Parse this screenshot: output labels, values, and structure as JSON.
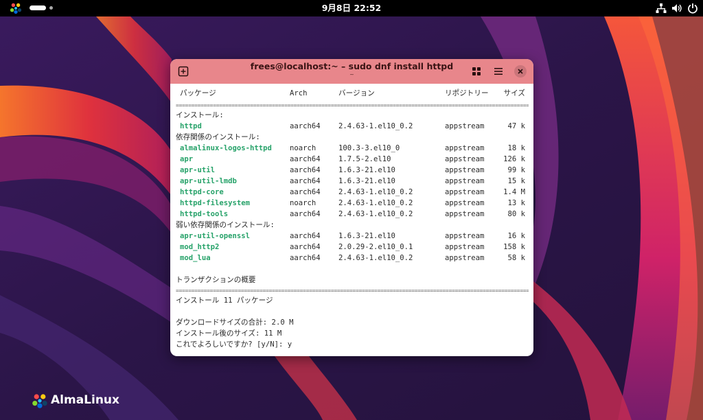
{
  "topbar": {
    "datetime": "9月8日  22:52"
  },
  "window": {
    "title": "frees@localhost:~ – sudo dnf install httpd",
    "subtitle": "~"
  },
  "terminal": {
    "headers": [
      "パッケージ",
      "Arch",
      "バージョン",
      "リポジトリー",
      "サイズ"
    ],
    "separator": "==================================================================================================================================",
    "install_label": "インストール:",
    "install_pkgs": [
      {
        "name": "httpd",
        "arch": "aarch64",
        "version": "2.4.63-1.el10_0.2",
        "repo": "appstream",
        "size": "47 k"
      }
    ],
    "dep_label": "依存関係のインストール:",
    "dep_pkgs": [
      {
        "name": "almalinux-logos-httpd",
        "arch": "noarch",
        "version": "100.3-3.el10_0",
        "repo": "appstream",
        "size": "18 k"
      },
      {
        "name": "apr",
        "arch": "aarch64",
        "version": "1.7.5-2.el10",
        "repo": "appstream",
        "size": "126 k"
      },
      {
        "name": "apr-util",
        "arch": "aarch64",
        "version": "1.6.3-21.el10",
        "repo": "appstream",
        "size": "99 k"
      },
      {
        "name": "apr-util-lmdb",
        "arch": "aarch64",
        "version": "1.6.3-21.el10",
        "repo": "appstream",
        "size": "15 k"
      },
      {
        "name": "httpd-core",
        "arch": "aarch64",
        "version": "2.4.63-1.el10_0.2",
        "repo": "appstream",
        "size": "1.4 M"
      },
      {
        "name": "httpd-filesystem",
        "arch": "noarch",
        "version": "2.4.63-1.el10_0.2",
        "repo": "appstream",
        "size": "13 k"
      },
      {
        "name": "httpd-tools",
        "arch": "aarch64",
        "version": "2.4.63-1.el10_0.2",
        "repo": "appstream",
        "size": "80 k"
      }
    ],
    "weak_label": "弱い依存関係のインストール:",
    "weak_pkgs": [
      {
        "name": "apr-util-openssl",
        "arch": "aarch64",
        "version": "1.6.3-21.el10",
        "repo": "appstream",
        "size": "16 k"
      },
      {
        "name": "mod_http2",
        "arch": "aarch64",
        "version": "2.0.29-2.el10_0.1",
        "repo": "appstream",
        "size": "158 k"
      },
      {
        "name": "mod_lua",
        "arch": "aarch64",
        "version": "2.4.63-1.el10_0.2",
        "repo": "appstream",
        "size": "58 k"
      }
    ],
    "summary_title": "トランザクションの概要",
    "summary_install": "インストール  11 パッケージ",
    "download_total": "ダウンロードサイズの合計: 2.0 M",
    "installed_size": "インストール後のサイズ: 11 M",
    "prompt": "これでよろしいですか? [y/N]: y"
  },
  "brand": {
    "name": "AlmaLinux"
  },
  "colors": {
    "titlebar": "#e8868b",
    "package_name": "#26a269",
    "topbar": "#000000"
  },
  "icons": [
    "almalinux-logo-icon",
    "network-icon",
    "volume-icon",
    "power-icon",
    "new-tab-icon",
    "grid-view-icon",
    "menu-icon",
    "close-icon"
  ]
}
